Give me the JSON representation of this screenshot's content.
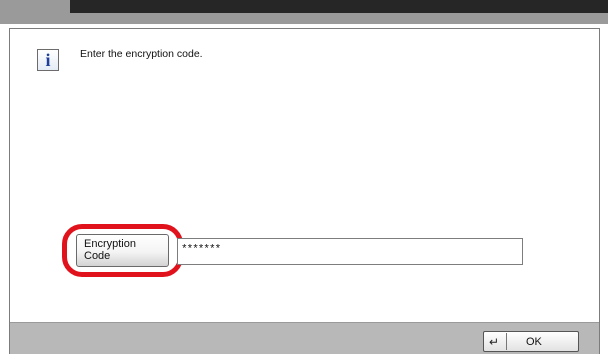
{
  "dialog": {
    "message": "Enter the encryption code."
  },
  "form": {
    "label_line1": "Encryption",
    "label_line2": "Code",
    "masked_value": "*******"
  },
  "footer": {
    "ok_label": "OK"
  },
  "icons": {
    "info": "info-icon",
    "enter": "enter-arrow-icon"
  },
  "colors": {
    "highlight": "#e0131d",
    "top_bar": "#9a9a9a",
    "bottom_bar": "#b8b8b8"
  }
}
